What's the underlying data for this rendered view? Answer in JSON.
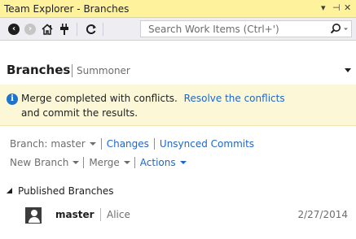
{
  "window": {
    "title": "Team Explorer - Branches",
    "controls": [
      "▾",
      "⊣",
      "✕"
    ]
  },
  "toolbar": {
    "back_icon": "back-arrow-icon",
    "forward_icon": "forward-arrow-icon",
    "home_icon": "home-icon",
    "connect_icon": "connect-plug-icon",
    "refresh_icon": "refresh-icon",
    "search": {
      "placeholder": "Search Work Items (Ctrl+')"
    }
  },
  "header": {
    "title": "Branches",
    "repo": "Summoner"
  },
  "notification": {
    "text1": "Merge completed with conflicts.",
    "link": "Resolve the conflicts",
    "text2": "and commit the results."
  },
  "actions_row1": {
    "branch_prefix": "Branch:",
    "branch_name": "master",
    "changes": "Changes",
    "unsynced": "Unsynced Commits"
  },
  "actions_row2": {
    "new_branch": "New Branch",
    "merge": "Merge",
    "actions": "Actions"
  },
  "section": {
    "title": "Published Branches"
  },
  "branches": [
    {
      "name": "master",
      "author": "Alice",
      "date": "2/27/2014"
    }
  ],
  "colors": {
    "title_bar": "#fff29d",
    "info_bar": "#fcf7d6",
    "link": "#1e66c8",
    "info_icon": "#1e74c8"
  }
}
